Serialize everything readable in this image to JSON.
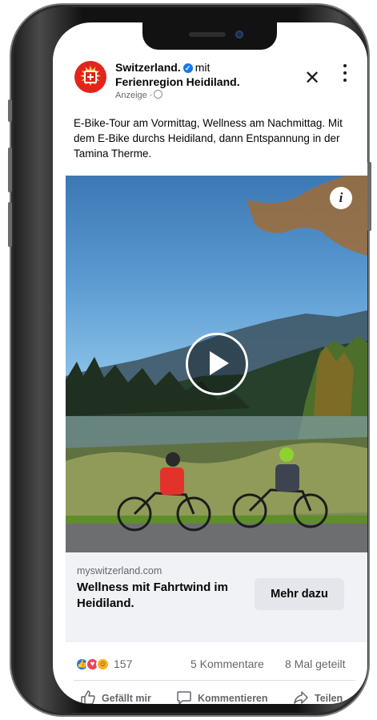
{
  "post": {
    "page_name": "Switzerland.",
    "with_label": "mit",
    "partner": "Ferienregion Heidiland.",
    "sponsored": "Anzeige ·",
    "caption": "E-Bike-Tour am Vormittag, Wellness am Nachmittag. Mit dem E-Bike durchs Heidiland, dann Entspannung in der Tamina Therme.",
    "info_label": "i"
  },
  "link": {
    "domain": "myswitzerland.com",
    "headline": "Wellness mit Fahrtwind im Heidiland.",
    "cta": "Mehr dazu"
  },
  "stats": {
    "reactions_count": "157",
    "comments": "5 Kommentare",
    "shares": "8 Mal geteilt"
  },
  "actions": {
    "like": "Gefällt mir",
    "comment": "Kommentieren",
    "share": "Teilen"
  },
  "icons": {
    "close": "close-icon",
    "more": "more-options-icon",
    "play": "play-icon",
    "info": "info-icon",
    "verified": "verified-badge-icon"
  },
  "colors": {
    "brand_red": "#e2241d",
    "facebook_blue": "#1877f2",
    "secondary_text": "#65676b"
  }
}
